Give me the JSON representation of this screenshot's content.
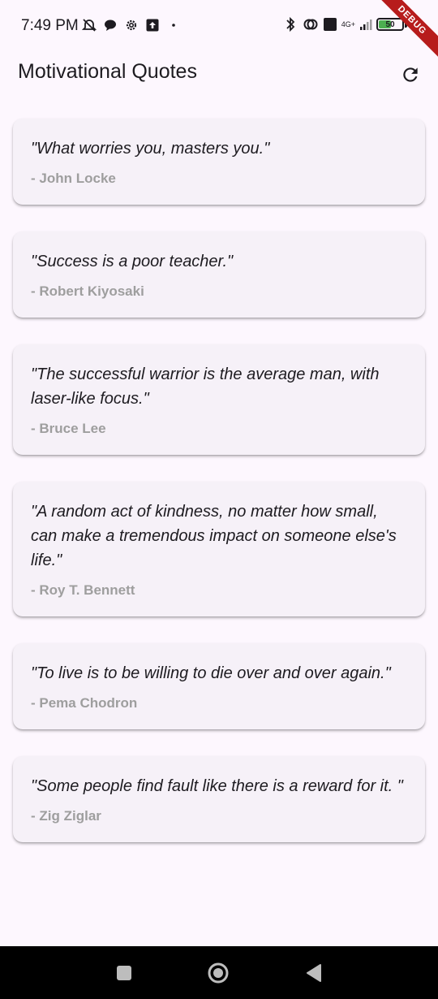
{
  "status_bar": {
    "time": "7:49 PM",
    "network_label": "4G+",
    "volte_label": "Vo LTE",
    "battery_level": "50",
    "battery_fraction": 0.5,
    "battery_color": "#4caf50"
  },
  "debug_banner": {
    "label": "DEBUG",
    "color": "#b71c1c"
  },
  "app_bar": {
    "title": "Motivational Quotes",
    "refresh_icon": "refresh-icon"
  },
  "quotes": [
    {
      "text": "\"What worries you, masters you.\"",
      "author": "- John Locke"
    },
    {
      "text": "\"Success is a poor teacher.\"",
      "author": "- Robert Kiyosaki"
    },
    {
      "text": "\"The successful warrior is the average man, with laser-like focus.\"",
      "author": "- Bruce Lee"
    },
    {
      "text": "\"A random act of kindness, no matter how small, can make a tremendous impact on someone else's life.\"",
      "author": "- Roy T. Bennett"
    },
    {
      "text": "\"To live is to be willing to die over and over again.\"",
      "author": "- Pema Chodron"
    },
    {
      "text": "\"Some people find fault like there is a reward for it.  \"",
      "author": "- Zig Ziglar"
    }
  ],
  "nav_bar": {
    "recents_icon": "square-icon",
    "home_icon": "circle-icon",
    "back_icon": "triangle-back-icon"
  }
}
